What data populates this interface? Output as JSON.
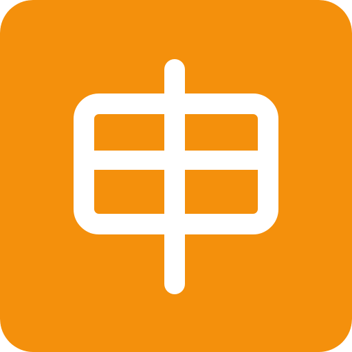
{
  "icon": {
    "name": "kanji-shin-icon",
    "character": "申",
    "background_color": "#F4900C",
    "glyph_color": "#FFFFFF"
  }
}
